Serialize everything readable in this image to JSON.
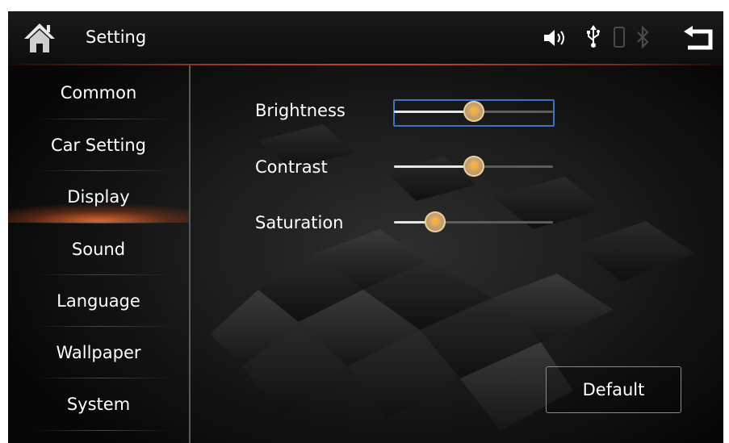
{
  "header": {
    "title": "Setting",
    "icons": [
      "home-icon",
      "volume-icon",
      "usb-icon",
      "phone-icon",
      "bluetooth-icon",
      "back-icon"
    ]
  },
  "sidebar": {
    "items": [
      {
        "label": "Common",
        "active": false
      },
      {
        "label": "Car Setting",
        "active": false
      },
      {
        "label": "Display",
        "active": true
      },
      {
        "label": "Sound",
        "active": false
      },
      {
        "label": "Language",
        "active": false
      },
      {
        "label": "Wallpaper",
        "active": false
      },
      {
        "label": "System",
        "active": false
      }
    ]
  },
  "display": {
    "sliders": [
      {
        "label": "Brightness",
        "level": 0.5,
        "focused": true
      },
      {
        "label": "Contrast",
        "level": 0.5,
        "focused": false
      },
      {
        "label": "Saturation",
        "level": 0.26,
        "focused": false
      }
    ],
    "default_label": "Default"
  },
  "colors": {
    "accent_orange": "#d9662e",
    "focus_blue": "#3d72c4",
    "thumb_gold": "#c9a06a"
  }
}
